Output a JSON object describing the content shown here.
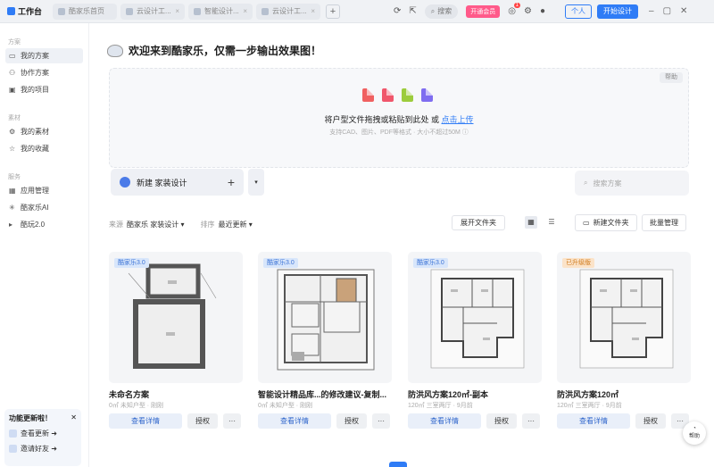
{
  "topbar": {
    "brand": "工作台",
    "tabs": [
      {
        "label": "酷家乐首页"
      },
      {
        "label": "云设计工..."
      },
      {
        "label": "智能设计..."
      },
      {
        "label": "云设计工..."
      }
    ],
    "add_tab": "+",
    "search_label": "搜索",
    "vip_label": "开通会员",
    "notif_count": "1",
    "member_label": "个人",
    "start_design": "开始设计"
  },
  "sidebar": {
    "sec1": "方案",
    "items1": [
      {
        "label": "我的方案"
      },
      {
        "label": "协作方案"
      },
      {
        "label": "我的项目"
      }
    ],
    "sec2": "素材",
    "items2": [
      {
        "label": "我的素材"
      },
      {
        "label": "我的收藏"
      }
    ],
    "sec3": "服务",
    "items3": [
      {
        "label": "应用管理"
      },
      {
        "label": "酷家乐AI"
      },
      {
        "label": "酷玩2.0"
      }
    ],
    "update": {
      "title": "功能更新啦！",
      "row1": "查看更新 ➜",
      "row2": "邀请好友 ➜"
    }
  },
  "main": {
    "welcome": "欢迎来到酷家乐，仅需一步输出效果图！",
    "upload": {
      "help": "帮助",
      "main_text": "将户型文件拖拽或粘贴到此处 或 ",
      "link": "点击上传",
      "sub_text": "支持CAD、图片、PDF等格式 · 大小不超过50M ⓘ"
    },
    "new_design": "新建 家装设计",
    "new_plus": "+",
    "drop": "▾",
    "search_placeholder": "搜索方案",
    "filters": {
      "l1": "来源",
      "v1": "酷家乐 家装设计 ▾",
      "l2": "排序",
      "v2": "最近更新 ▾"
    },
    "expand": "展开文件夹",
    "new_folder": "新建文件夹",
    "batch": "批量管理"
  },
  "cards": [
    {
      "tag": "酷家乐3.0",
      "title": "未命名方案",
      "meta": "0㎡ 未知户型 · 刚刚",
      "detail": "查看详情",
      "render": "授权",
      "more": "···"
    },
    {
      "tag": "酷家乐3.0",
      "title": "智能设计精品库...的修改建议-复制...",
      "meta": "0㎡ 未知户型 · 刚刚",
      "detail": "查看详情",
      "render": "授权",
      "more": "···"
    },
    {
      "tag": "酷家乐3.0",
      "title": "防洪风方案120㎡-副本",
      "meta": "120㎡ 三室两厅 · 9月前",
      "detail": "查看详情",
      "render": "授权",
      "more": "···"
    },
    {
      "tag": "已升级版",
      "title": "防洪风方案120㎡",
      "meta": "120㎡ 三室两厅 · 9月前",
      "detail": "查看详情",
      "render": "授权",
      "more": "···"
    }
  ],
  "help_float": "帮助",
  "colors": {
    "accent": "#2f7cf6",
    "vip": "#ff5a8a"
  }
}
